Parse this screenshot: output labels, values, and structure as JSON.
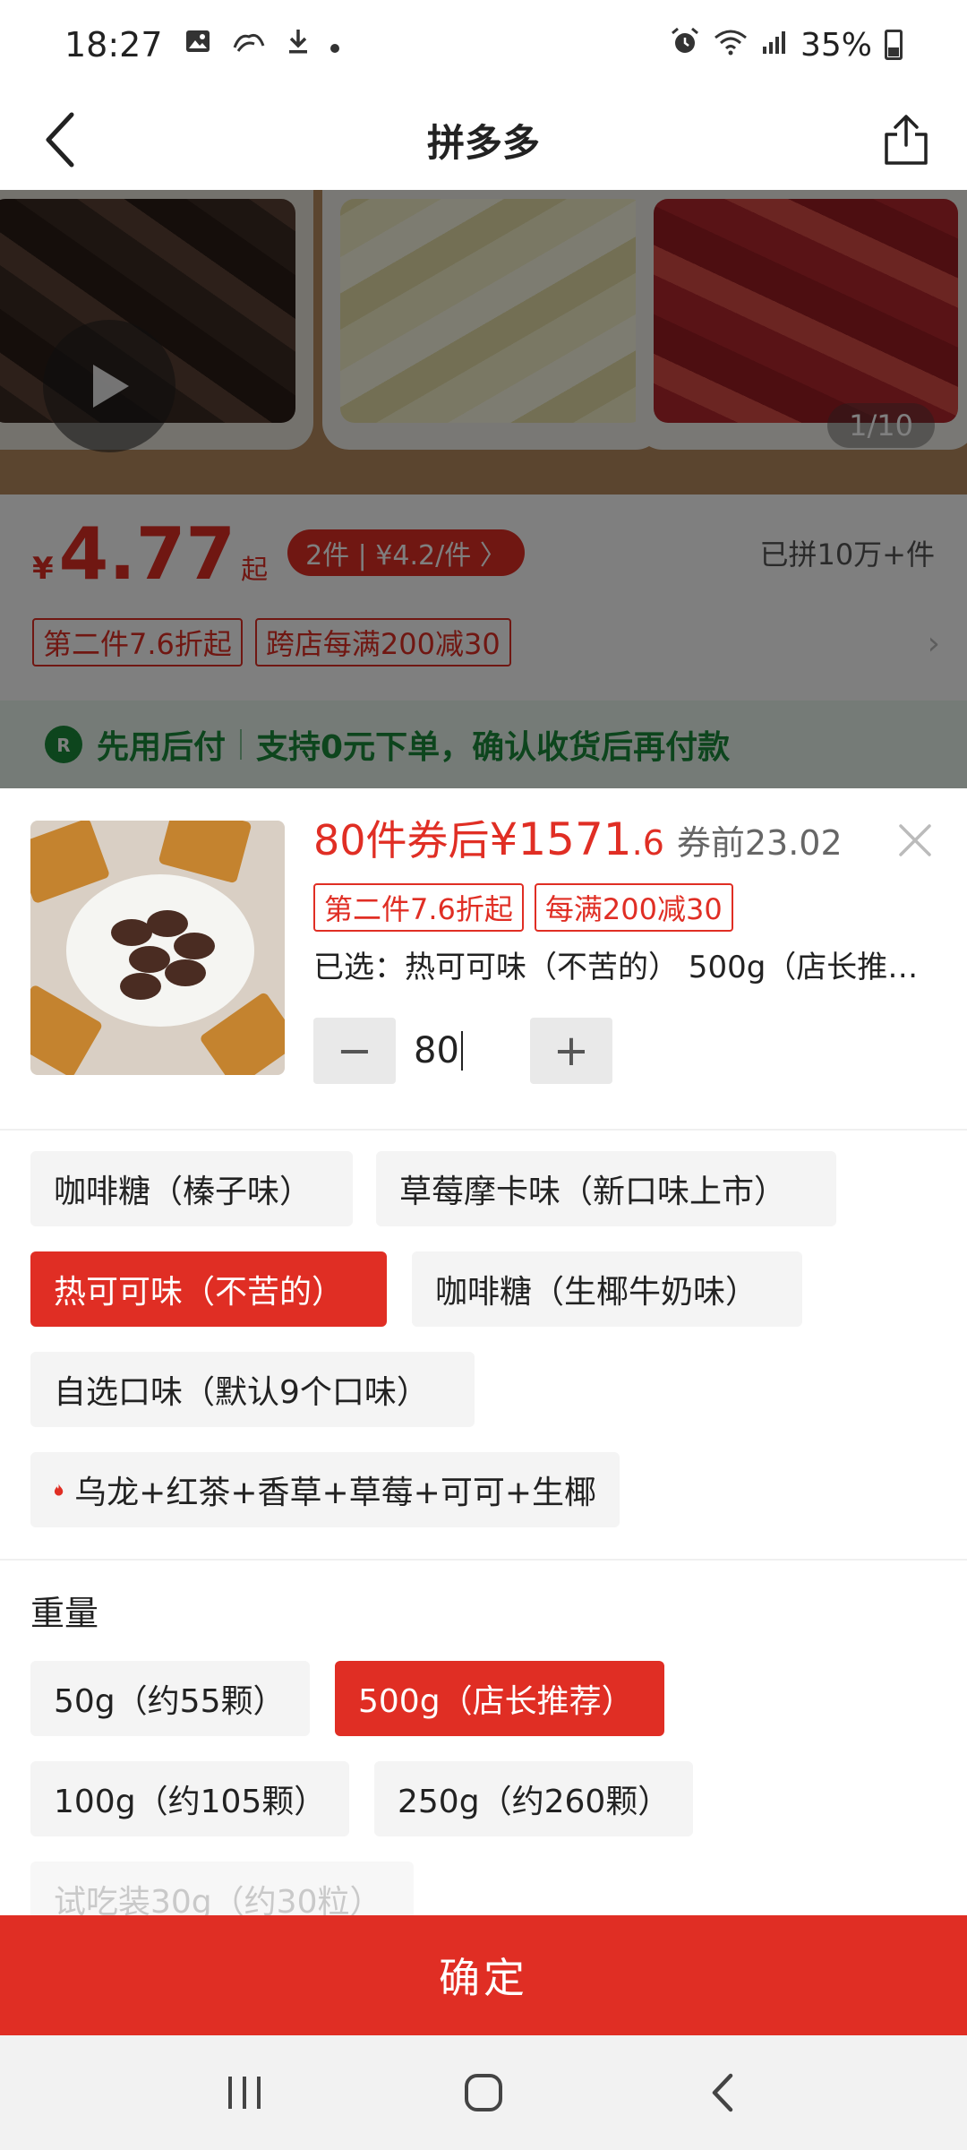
{
  "status_bar": {
    "time": "18:27",
    "battery": "35%",
    "icons": [
      "image-icon",
      "gamepad-icon",
      "download-icon",
      "dot-icon",
      "alarm-icon",
      "wifi-icon",
      "signal-icon",
      "battery-icon"
    ]
  },
  "nav": {
    "title": "拼多多"
  },
  "product": {
    "image_counter": "1/10",
    "currency": "¥",
    "price": "4.77",
    "price_suffix": "起",
    "group_offer": "2件 | ¥4.2/件 〉",
    "sold": "已拼10万+件",
    "promo_tags": [
      "第二件7.6折起",
      "跨店每满200减30"
    ],
    "pay_later": {
      "title": "先用后付",
      "desc": "支持0元下单，确认收货后再付款"
    }
  },
  "sku_sheet": {
    "qty_coupon_label": "80件券后",
    "total_price_int": "¥1571",
    "total_price_dec": ".6",
    "original_price": "券前23.02",
    "tags": [
      "第二件7.6折起",
      "每满200减30"
    ],
    "selected": "已选：热可可味（不苦的） 500g（店长推荐）",
    "quantity": "80",
    "minus": "−",
    "plus": "+",
    "flavors": [
      "咖啡糖（榛子味）",
      "草莓摩卡味（新口味上市）",
      "热可可味（不苦的）",
      "咖啡糖（生椰牛奶味）",
      "自选口味（默认9个口味）",
      "乌龙+红茶+香草+草莓+可可+生椰"
    ],
    "selected_flavor": "热可可味（不苦的）",
    "weight_label": "重量",
    "weights": [
      "50g（约55颗）",
      "500g（店长推荐）",
      "100g（约105颗）",
      "250g（约260颗）",
      "试吃装30g（约30粒）"
    ],
    "selected_weight": "500g（店长推荐）",
    "disabled_weight": "试吃装30g（约30粒）",
    "confirm": "确定"
  },
  "colors": {
    "accent": "#e02e24",
    "green": "#1a8a3a"
  }
}
